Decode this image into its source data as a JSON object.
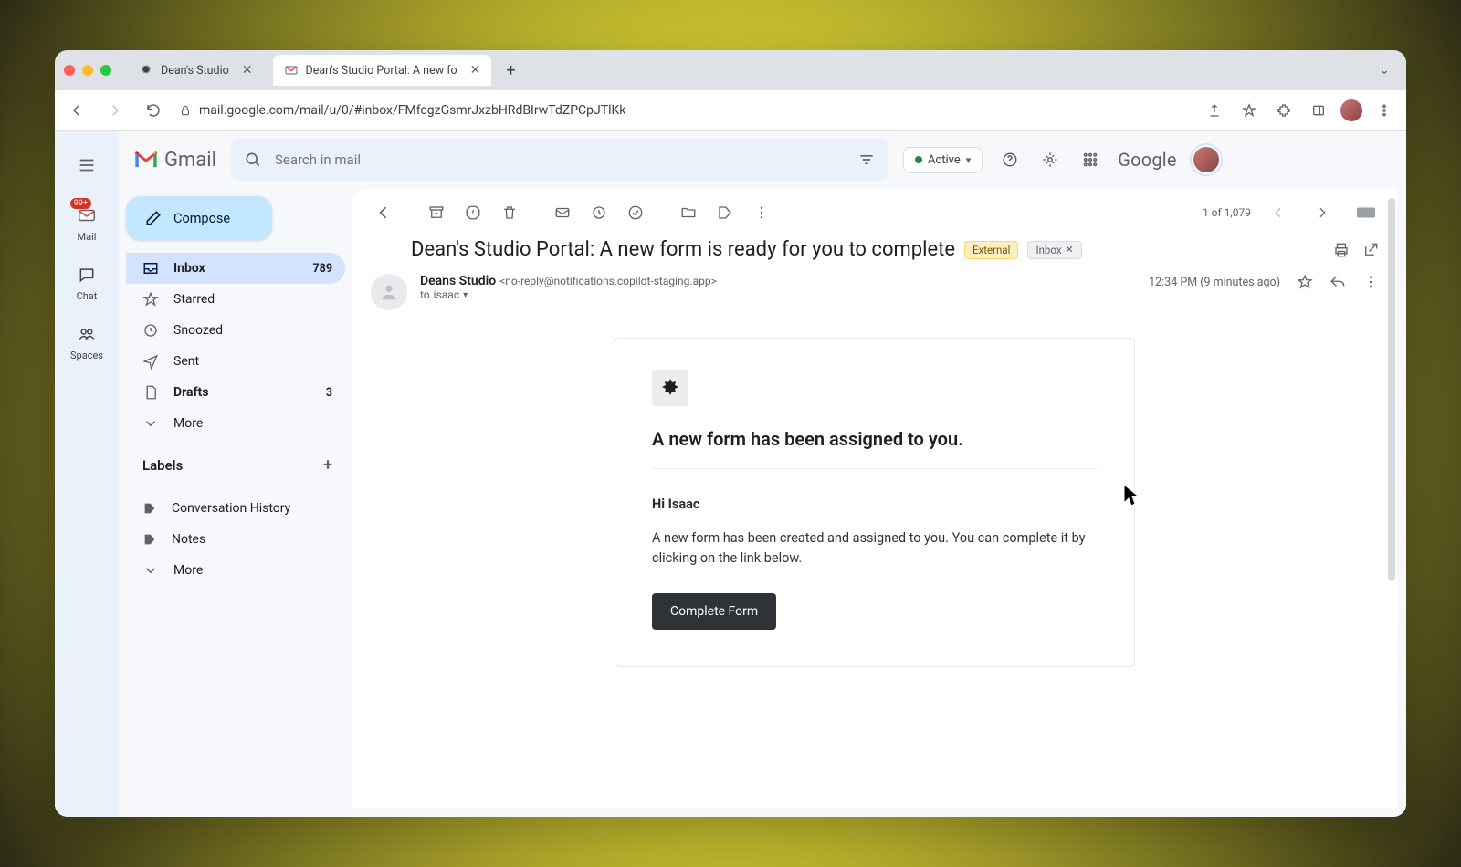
{
  "browser": {
    "tab1_title": "Dean's Studio",
    "tab2_title": "Dean's Studio Portal: A new fo",
    "url": "mail.google.com/mail/u/0/#inbox/FMfcgzGsmrJxzbHRdBIrwTdZPCpJTlKk"
  },
  "header": {
    "product": "Gmail",
    "search_placeholder": "Search in mail",
    "status": "Active",
    "brand": "Google"
  },
  "rail": {
    "mail": "Mail",
    "chat": "Chat",
    "spaces": "Spaces",
    "badge": "99+"
  },
  "compose_label": "Compose",
  "nav": {
    "inbox": "Inbox",
    "inbox_count": "789",
    "starred": "Starred",
    "snoozed": "Snoozed",
    "sent": "Sent",
    "drafts": "Drafts",
    "drafts_count": "3",
    "more": "More"
  },
  "labels": {
    "header": "Labels",
    "conv": "Conversation History",
    "notes": "Notes",
    "more": "More"
  },
  "toolbar": {
    "counter": "1 of 1,079"
  },
  "subject": {
    "text": "Dean's Studio Portal: A new form is ready for you to complete",
    "chip_external": "External",
    "chip_inbox": "Inbox"
  },
  "sender": {
    "name": "Deans Studio",
    "email": "<no-reply@notifications.copilot-staging.app>",
    "to_prefix": "to ",
    "to_name": "isaac",
    "time": "12:34 PM (9 minutes ago)"
  },
  "email": {
    "heading": "A new form has been assigned to you.",
    "greeting": "Hi Isaac",
    "body": "A new form has been created and assigned to you. You can complete it by clicking on the link below.",
    "cta": "Complete Form"
  }
}
